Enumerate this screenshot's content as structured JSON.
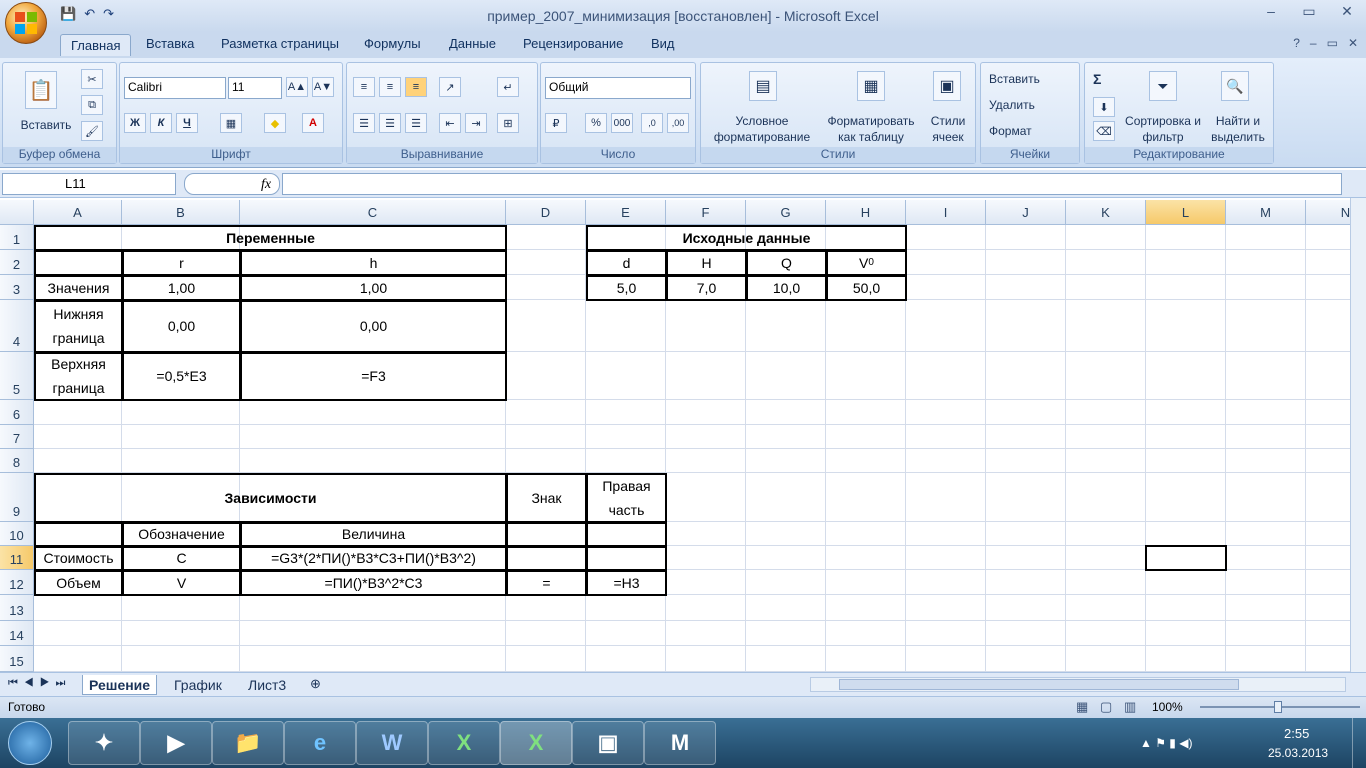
{
  "window": {
    "title": "пример_2007_минимизация [восстановлен] - Microsoft Excel",
    "minimize": "–",
    "maximize": "▭",
    "close": "✕"
  },
  "qat": {
    "save": "💾",
    "undo": "↶",
    "redo": "↷"
  },
  "tabs": [
    "Главная",
    "Вставка",
    "Разметка страницы",
    "Формулы",
    "Данные",
    "Рецензирование",
    "Вид"
  ],
  "ribbon": {
    "clipboard": {
      "label": "Буфер обмена",
      "paste": "Вставить"
    },
    "font": {
      "label": "Шрифт",
      "name": "Calibri",
      "size": "11",
      "bold": "Ж",
      "italic": "К",
      "underline": "Ч"
    },
    "alignment": {
      "label": "Выравнивание"
    },
    "number": {
      "label": "Число",
      "format": "Общий",
      "percent": "%",
      "thousands": "000"
    },
    "styles": {
      "label": "Стили",
      "conditional": "Условное форматирование",
      "as_table": "Форматировать как таблицу",
      "cell_styles": "Стили ячеек"
    },
    "cells": {
      "label": "Ячейки",
      "insert": "Вставить",
      "delete": "Удалить",
      "format": "Формат"
    },
    "editing": {
      "label": "Редактирование",
      "sort": "Сортировка и фильтр",
      "find": "Найти и выделить",
      "sum": "Σ"
    }
  },
  "formula_bar": {
    "name_box": "L11",
    "fx": "fx",
    "content": ""
  },
  "columns": [
    "A",
    "B",
    "C",
    "D",
    "E",
    "F",
    "G",
    "H",
    "I",
    "J",
    "K",
    "L",
    "M",
    "N"
  ],
  "rows": [
    "1",
    "2",
    "3",
    "4",
    "5",
    "6",
    "7",
    "8",
    "9",
    "10",
    "11",
    "12",
    "13",
    "14",
    "15"
  ],
  "cells": {
    "r1_vars": "Переменные",
    "r1_src": "Исходные данные",
    "r2_r": "r",
    "r2_h": "h",
    "r2_d": "d",
    "r2_H": "H",
    "r2_Q": "Q",
    "r2_V": "V",
    "r2_V_sub": "0",
    "r3_label": "Значения",
    "r3_b": "1,00",
    "r3_c": "1,00",
    "r3_e": "5,0",
    "r3_f": "7,0",
    "r3_g": "10,0",
    "r3_h": "50,0",
    "r4_label": "Нижняя граница",
    "r4_b": "0,00",
    "r4_c": "0,00",
    "r5_label": "Верхняя граница",
    "r5_b": "=0,5*E3",
    "r5_c": "=F3",
    "r9_deps": "Зависимости",
    "r9_sign": "Знак",
    "r9_right": "Правая часть",
    "r10_b": "Обозначение",
    "r10_c": "Величина",
    "r11_a": "Стоимость",
    "r11_b": "C",
    "r11_c": "=G3*(2*ПИ()*B3*C3+ПИ()*B3^2)",
    "r12_a": "Объем",
    "r12_b": "V",
    "r12_c": "=ПИ()*B3^2*C3",
    "r12_d": "=",
    "r12_e": "=H3"
  },
  "sheets": [
    "Решение",
    "График",
    "Лист3"
  ],
  "status": {
    "ready": "Готово",
    "zoom": "100%"
  },
  "taskbar": {
    "time": "2:55",
    "date": "25.03.2013"
  }
}
